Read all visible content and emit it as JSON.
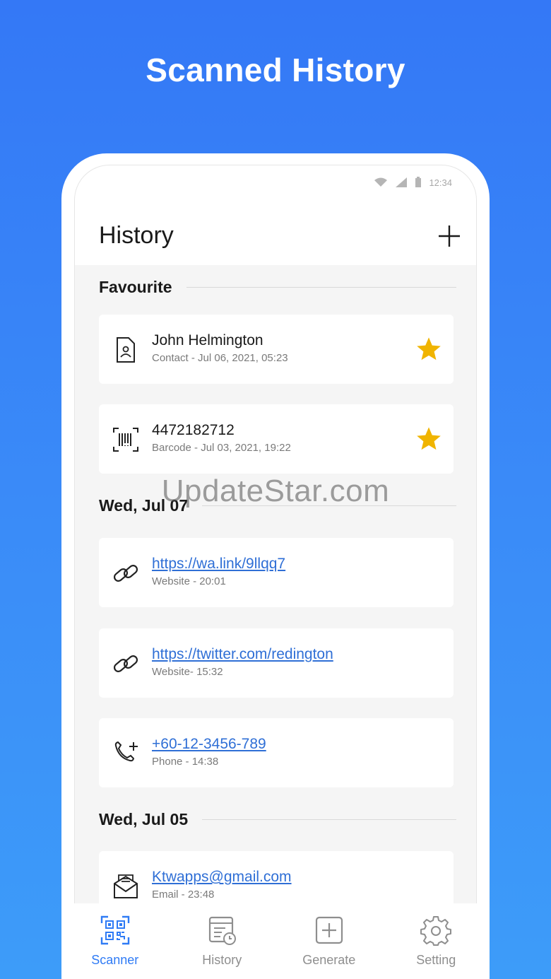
{
  "promo": {
    "title": "Scanned History"
  },
  "status_bar": {
    "time": "12:34"
  },
  "header": {
    "title": "History"
  },
  "sections": {
    "favourite": "Favourite",
    "wed_jul_07": "Wed, Jul 07",
    "wed_jul_05": "Wed, Jul 05"
  },
  "items": [
    {
      "title": "John Helmington",
      "subtitle": "Contact - Jul 06, 2021, 05:23",
      "icon": "contact-icon",
      "favourite": true
    },
    {
      "title": "4472182712",
      "subtitle": "Barcode - Jul 03, 2021, 19:22",
      "icon": "barcode-icon",
      "favourite": true
    },
    {
      "title": "https://wa.link/9llqq7",
      "subtitle": "Website - 20:01",
      "icon": "link-icon",
      "favourite": false
    },
    {
      "title": "https://twitter.com/redington",
      "subtitle": "Website- 15:32",
      "icon": "link-icon",
      "favourite": false
    },
    {
      "title": "+60-12-3456-789",
      "subtitle": "Phone - 14:38",
      "icon": "phone-add-icon",
      "favourite": false
    },
    {
      "title": "Ktwapps@gmail.com",
      "subtitle": "Email - 23:48",
      "icon": "email-icon",
      "favourite": false
    }
  ],
  "watermark": "UpdateStar.com",
  "nav": [
    {
      "label": "Scanner",
      "icon": "qr-scanner-icon",
      "active": true
    },
    {
      "label": "History",
      "icon": "history-icon",
      "active": false
    },
    {
      "label": "Generate",
      "icon": "generate-icon",
      "active": false
    },
    {
      "label": "Setting",
      "icon": "gear-icon",
      "active": false
    }
  ],
  "colors": {
    "background": "#3478f6",
    "accent": "#2f7bf5",
    "link": "#2f6fd6",
    "star": "#f0b400"
  }
}
